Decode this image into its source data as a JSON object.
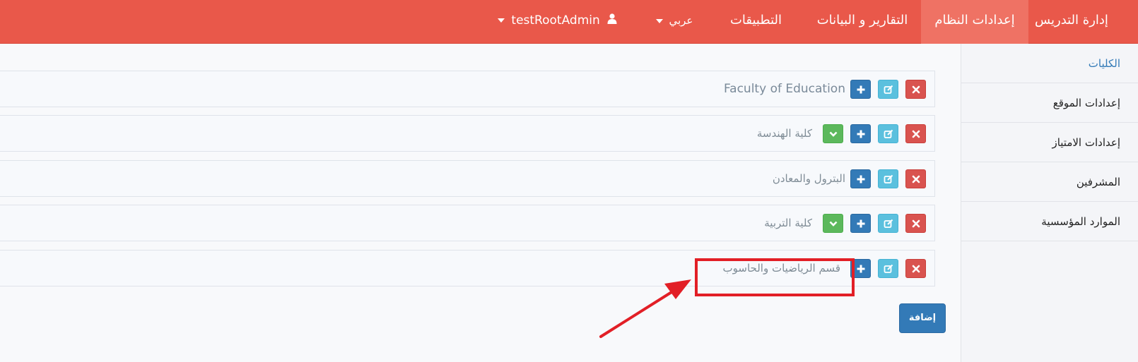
{
  "navbar": {
    "items": [
      {
        "label": "إدارة التدريس"
      },
      {
        "label": "إعدادات النظام"
      },
      {
        "label": "التقارير و البيانات"
      },
      {
        "label": "التطبيقات"
      },
      {
        "label": "عربي"
      },
      {
        "label": "testRootAdmin"
      }
    ],
    "colors": {
      "bar": "#e9584a",
      "active": "#ef7264"
    }
  },
  "sidebar": {
    "items": [
      {
        "label": "الكليات"
      },
      {
        "label": "إعدادات الموقع"
      },
      {
        "label": "إعدادات الامتياز"
      },
      {
        "label": "المشرفين"
      },
      {
        "label": "الموارد المؤسسية"
      }
    ]
  },
  "faculties": [
    {
      "name": "Faculty of Education",
      "has_check": false
    },
    {
      "name": "كلية الهندسة",
      "has_check": true
    },
    {
      "name": "البترول والمعادن",
      "has_check": false
    },
    {
      "name": "كلية التربية",
      "has_check": true
    },
    {
      "name": "قسم الرياضيات والحاسوب",
      "has_check": false
    }
  ],
  "actions": {
    "add_label": "إضافة"
  },
  "icons": {
    "delete": "close-icon",
    "edit": "edit-icon",
    "add": "plus-icon",
    "check": "chevron-down-icon",
    "user": "user-icon",
    "dropdown": "caret-down-icon"
  }
}
